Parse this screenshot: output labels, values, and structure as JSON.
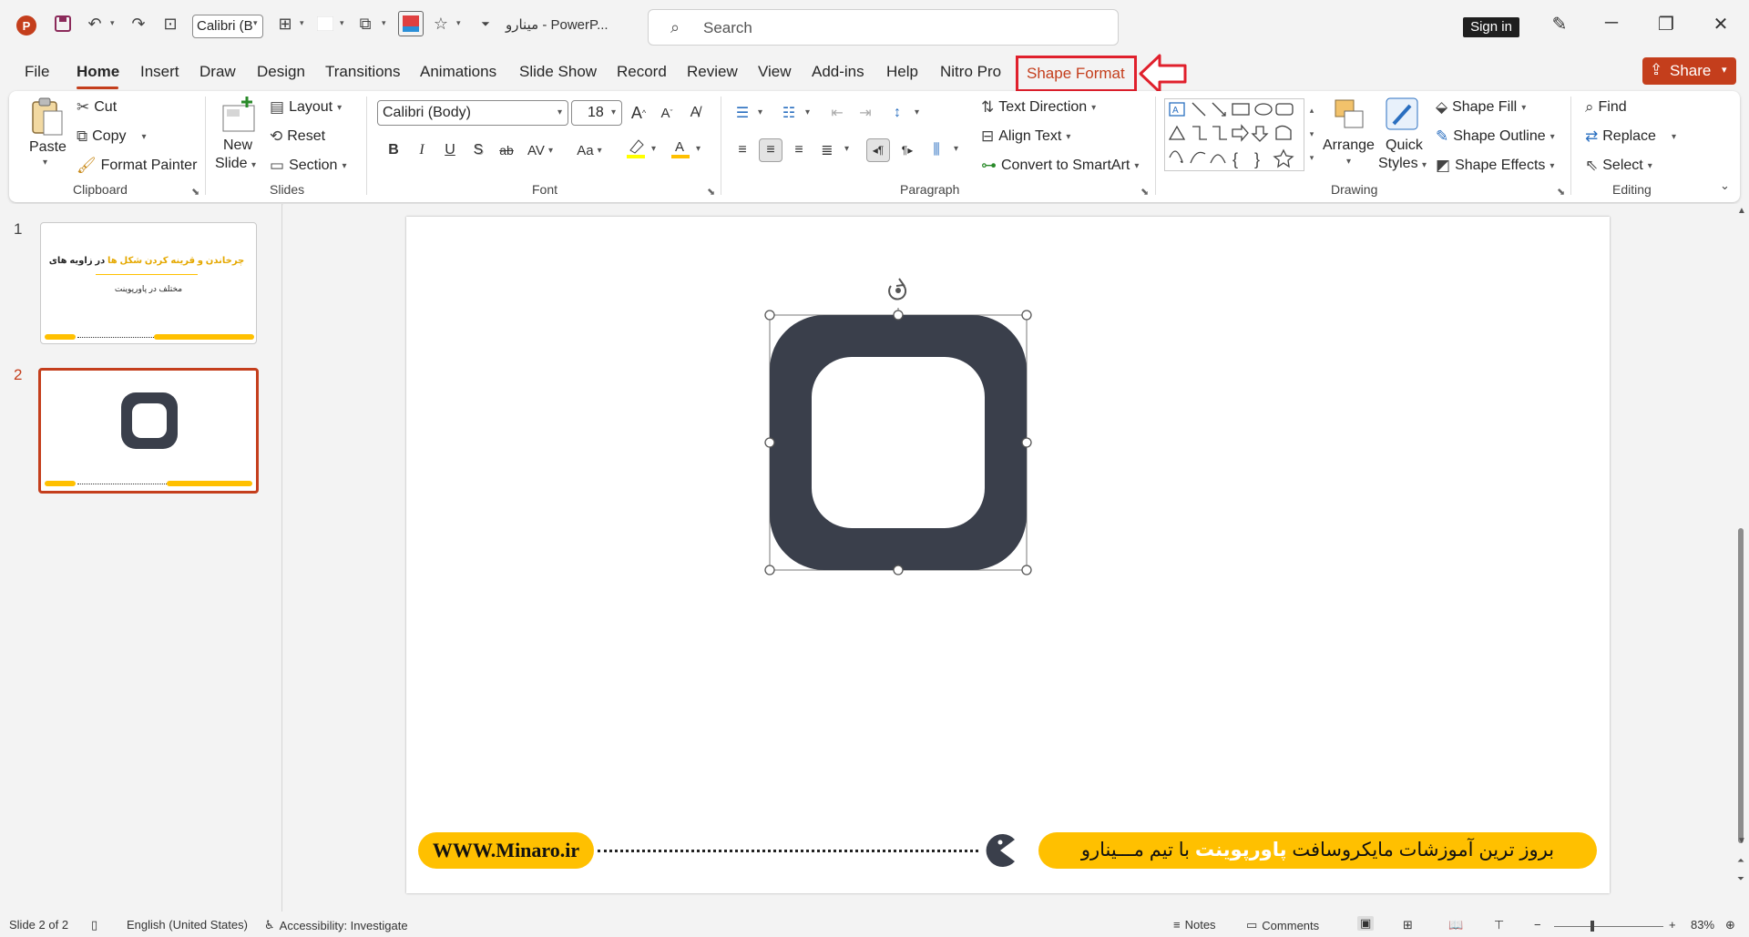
{
  "titlebar": {
    "logo": "P",
    "font_name": "Calibri (B",
    "doc_name": "مینارو",
    "app_name": "-  PowerP...",
    "search_placeholder": "Search",
    "sign_in": "Sign in"
  },
  "tabs": [
    "File",
    "Home",
    "Insert",
    "Draw",
    "Design",
    "Transitions",
    "Animations",
    "Slide Show",
    "Record",
    "Review",
    "View",
    "Add-ins",
    "Help",
    "Nitro Pro"
  ],
  "active_tab": "Home",
  "highlighted_tab": "Shape Format",
  "share_label": "Share",
  "ribbon": {
    "clipboard": {
      "paste": "Paste",
      "cut": "Cut",
      "copy": "Copy",
      "format_painter": "Format Painter",
      "label": "Clipboard"
    },
    "slides": {
      "new_slide_1": "New",
      "new_slide_2": "Slide",
      "layout": "Layout",
      "reset": "Reset",
      "section": "Section",
      "label": "Slides"
    },
    "font": {
      "family": "Calibri (Body)",
      "size": "18",
      "bold": "B",
      "italic": "I",
      "underline": "U",
      "shadow": "S",
      "strike": "ab",
      "spacing": "AV",
      "case": "Aa",
      "label": "Font"
    },
    "paragraph": {
      "text_direction": "Text Direction",
      "align_text": "Align Text",
      "convert_smartart": "Convert to SmartArt",
      "label": "Paragraph"
    },
    "drawing": {
      "arrange": "Arrange",
      "quick_1": "Quick",
      "quick_2": "Styles",
      "shape_fill": "Shape Fill",
      "shape_outline": "Shape Outline",
      "shape_effects": "Shape Effects",
      "label": "Drawing"
    },
    "editing": {
      "find": "Find",
      "replace": "Replace",
      "select": "Select",
      "label": "Editing"
    }
  },
  "slides_panel": [
    {
      "number": "1",
      "title_highlight": "چرخاندن و قرینه کردن شکل ها",
      "title_rest": "در زاویه های",
      "subtitle": "مختلف در پاورپوینت"
    },
    {
      "number": "2"
    }
  ],
  "slide": {
    "banner_prefix": "بروز ترین آموزشات مایکروسافت",
    "banner_highlight": "پاورپوینت",
    "banner_suffix": "با تیم مـــینارو",
    "website": "WWW.Minaro.ir",
    "shape_color": "#3a3f4b"
  },
  "statusbar": {
    "slide_info": "Slide 2 of 2",
    "language": "English (United States)",
    "accessibility": "Accessibility: Investigate",
    "notes": "Notes",
    "comments": "Comments",
    "zoom_minus": "−",
    "zoom_plus": "+",
    "zoom": "83%"
  },
  "colors": {
    "accent": "#c43e1c",
    "highlight_box": "#e0202c",
    "banner": "#ffc000"
  }
}
